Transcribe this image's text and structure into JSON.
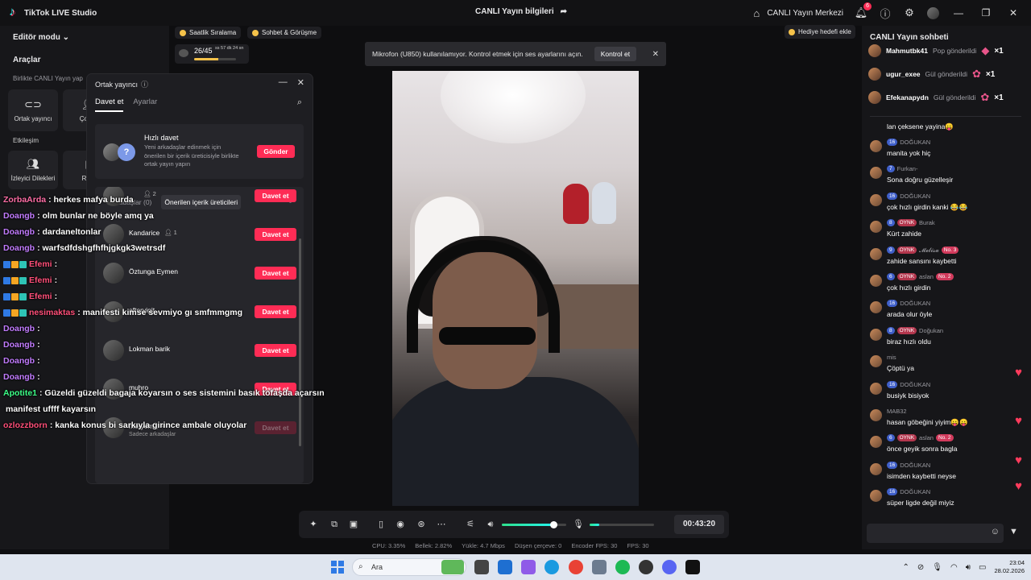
{
  "titlebar": {
    "app_name": "TikTok LIVE Studio",
    "live_info": "CANLI Yayın bilgileri",
    "live_center": "CANLI Yayın Merkezi",
    "notif_count": "6"
  },
  "left": {
    "editor_mode": "Editör modu",
    "tools_title": "Araçlar",
    "together_sub": "Birlikte CANLI Yayın yap",
    "tools": [
      "Ortak yayıncı",
      "Çoklu"
    ],
    "engagement_title": "Etkileşim",
    "engagement_tools": [
      "İzleyici Dilekleri",
      "Reh"
    ]
  },
  "top_pills": {
    "hourly": "Saatlik Sıralama",
    "chat_meet": "Sohbet & Görüşme",
    "rank_value": "26/45",
    "rank_time": "ss 57 dk 24 sn",
    "rank_progress": 0.58,
    "gift_goal": "Hediye hedefi ekle"
  },
  "mic_banner": {
    "text": "Mikrofon (U850) kullanılamıyor. Kontrol etmek için ses ayarlarını açın.",
    "button": "Kontrol et"
  },
  "cohost": {
    "title": "Ortak yayıncı",
    "tabs": [
      "Davet et",
      "Ayarlar"
    ],
    "quick_title": "Hızlı davet",
    "quick_desc": "Yeni arkadaşlar edinmek için önerilen bir içerik üreticisiyle birlikte ortak yayın yapın",
    "quick_button": "Gönder",
    "friends_tab": "Arkadaşlar (0)",
    "suggested_tab": "Önerilen içerik üreticileri",
    "invite_label": "Davet et",
    "friends": [
      {
        "name": "",
        "count": "2",
        "sub": ""
      },
      {
        "name": "Kandarice",
        "count": "1",
        "sub": ""
      },
      {
        "name": "Öztunga Eymen",
        "count": "",
        "sub": ""
      },
      {
        "name": "afteryigit",
        "count": "",
        "sub": ""
      },
      {
        "name": "Lokman barik",
        "count": "",
        "sub": ""
      },
      {
        "name": "muhro",
        "count": "",
        "sub": ""
      },
      {
        "name": "meryem",
        "count": "4",
        "sub": "Sadece arkadaşlar"
      }
    ]
  },
  "overlay_chat": [
    {
      "user": "",
      "msg": "",
      "color": "red"
    },
    {
      "user": "ZorbaArda",
      "msg": ": herkes mafya burda",
      "color": "pink"
    },
    {
      "user": "Doangb",
      "msg": ": olm bunlar ne böyle amq ya",
      "color": ""
    },
    {
      "user": "Doangb",
      "msg": ": dardaneltonlar",
      "color": ""
    },
    {
      "user": "Doangb",
      "msg": ": warfsdfdshgfhfhjgkgk3wetrsdf",
      "color": ""
    },
    {
      "user": "Efemi",
      "msg": ":",
      "color": "red",
      "badges": true
    },
    {
      "user": "Efemi",
      "msg": ":",
      "color": "red",
      "badges": true
    },
    {
      "user": "Efemi",
      "msg": ":",
      "color": "red",
      "badges": true
    },
    {
      "user": "nesimaktas",
      "msg": ": manifesti kimse sevmiyo gı smfmmgmg",
      "color": "red",
      "badges": true
    },
    {
      "user": "Doangb",
      "msg": ":",
      "color": ""
    },
    {
      "user": "Doangb",
      "msg": ":",
      "color": ""
    },
    {
      "user": "Doangb",
      "msg": ":",
      "color": ""
    },
    {
      "user": "Doangb",
      "msg": ":",
      "color": ""
    },
    {
      "user": "Apotite1",
      "msg": ": Güzeldi güzeldi bagaja koyarsın o ses sistemini basık tofaşda açarsın",
      "color": "green"
    },
    {
      "user": "",
      "msg": "manifest uffff kayarsın",
      "color": ""
    },
    {
      "user": "ozlozzborn",
      "msg": ": kanka konus bi sarkıyla girince ambale oluyolar",
      "color": "red"
    }
  ],
  "controls": {
    "timer": "00:43:20",
    "volume_level": 0.8,
    "mic_level": 0.15
  },
  "status": {
    "cpu": "CPU: 3.35%",
    "memory": "Bellek: 2.82%",
    "upload": "Yükle: 4.7 Mbps",
    "dropped": "Düşen çerçeve: 0",
    "encoder_fps": "Encoder FPS: 30",
    "fps": "FPS: 30"
  },
  "chat": {
    "title": "CANLI Yayın sohbeti",
    "gifts": [
      {
        "name": "Mahmutbk41",
        "sent": "Pop gönderildi",
        "count": "×1"
      },
      {
        "name": "ugur_exee",
        "sent": "Gül gönderildi",
        "count": "×1"
      },
      {
        "name": "Efekanapydn",
        "sent": "Gül gönderildi",
        "count": "×1"
      }
    ],
    "messages": [
      {
        "level": "",
        "oynk": "",
        "name": "",
        "no": "",
        "text": "lan çeksene yayina😛"
      },
      {
        "level": "16",
        "oynk": "",
        "name": "DOĞUKAN",
        "no": "",
        "text": "manita yok hiç"
      },
      {
        "level": "7",
        "oynk": "",
        "name": "Furkan-",
        "no": "",
        "text": "Sona doğru güzelleşir"
      },
      {
        "level": "16",
        "oynk": "",
        "name": "DOĞUKAN",
        "no": "",
        "text": "çok hızlı girdin kanki 😂😂"
      },
      {
        "level": "8",
        "oynk": "OYNK",
        "name": "Burak",
        "no": "",
        "text": "Kürt zahide"
      },
      {
        "level": "9",
        "oynk": "OYNK",
        "name": "𝓜𝓮𝓵𝓲𝓼𝓪",
        "no": "No. 3",
        "text": "zahide sansını kaybetti"
      },
      {
        "level": "6",
        "oynk": "OYNK",
        "name": "aslan",
        "no": "No. 2",
        "text": "çok hızlı girdin"
      },
      {
        "level": "16",
        "oynk": "",
        "name": "DOĞUKAN",
        "no": "",
        "text": "arada olur öyle"
      },
      {
        "level": "8",
        "oynk": "OYNK",
        "name": "Doğukan",
        "no": "",
        "text": "biraz hızlı oldu"
      },
      {
        "level": "",
        "oynk": "",
        "name": "mis",
        "no": "",
        "text": "Çöptü ya"
      },
      {
        "level": "16",
        "oynk": "",
        "name": "DOĞUKAN",
        "no": "",
        "text": "busiyk bisiyok"
      },
      {
        "level": "",
        "oynk": "",
        "name": "MAB32",
        "no": "",
        "text": "hasan göbeğini yiyim😛😛"
      },
      {
        "level": "6",
        "oynk": "OYNK",
        "name": "aslan",
        "no": "No. 2",
        "text": "önce geyik sonra bagla"
      },
      {
        "level": "16",
        "oynk": "",
        "name": "DOĞUKAN",
        "no": "",
        "text": "isimden kaybetti neyse"
      },
      {
        "level": "16",
        "oynk": "",
        "name": "DOĞUKAN",
        "no": "",
        "text": "süper ligde değil miyiz"
      }
    ]
  },
  "taskbar": {
    "search": "Ara",
    "time": "23:04",
    "date": "28.02.2026"
  }
}
